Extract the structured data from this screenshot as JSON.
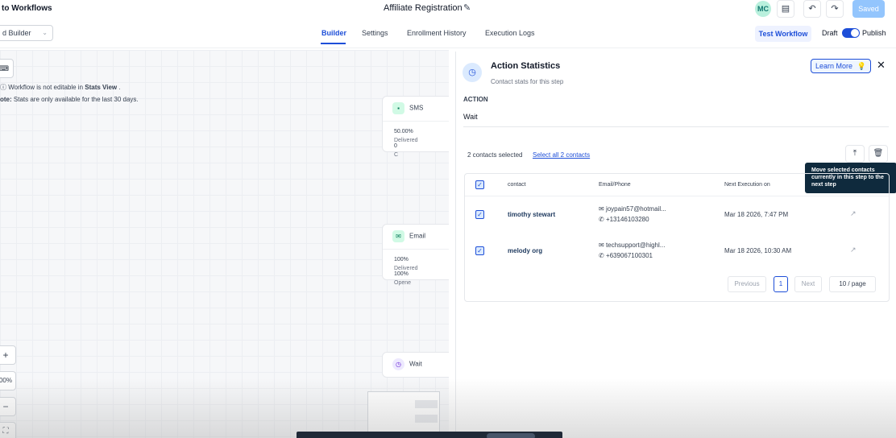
{
  "header": {
    "back_label": "to Workflows",
    "workflow_title": "Affiliate Registration",
    "avatar_initials": "MC",
    "saved_label": "Saved"
  },
  "navbar": {
    "builder_select_value": "d Builder",
    "tabs": [
      {
        "label": "Builder",
        "active": true
      },
      {
        "label": "Settings",
        "active": false
      },
      {
        "label": "Enrollment History",
        "active": false
      },
      {
        "label": "Execution Logs",
        "active": false
      }
    ],
    "test_workflow_label": "Test Workflow",
    "draft_label": "Draft",
    "publish_label": "Publish"
  },
  "canvas": {
    "note1_prefix": "Workflow is not editable in ",
    "note1_bold": "Stats View",
    "note1_suffix": " .",
    "note2_prefix": "ote:",
    "note2_text": " Stats are only available for the last 30 days.",
    "nodes": [
      {
        "name": "SMS",
        "stat1_value": "50.00%",
        "stat1_label": "Delivered",
        "stat2_value": "0",
        "stat2_label": "C"
      },
      {
        "name": "Email",
        "stat1_value": "100%",
        "stat1_label": "Delivered",
        "stat2_value": "100%",
        "stat2_label": "Opene"
      },
      {
        "name": "Wait"
      }
    ],
    "zoom_in": "+",
    "zoom_level": "00%",
    "zoom_out": "−",
    "fit": "⛶"
  },
  "panel": {
    "title": "Action Statistics",
    "subtitle": "Contact stats for this step",
    "learn_more": "Learn More",
    "action_label": "ACTION",
    "action_value": "Wait",
    "selected_count": "2 contacts selected",
    "select_all": "Select all 2 contacts",
    "tooltip": "Move selected contacts currently in this step to the next step",
    "table": {
      "headers": {
        "contact": "contact",
        "email_phone": "Email/Phone",
        "next_execution": "Next Execution on"
      },
      "rows": [
        {
          "contact": "timothy stewart",
          "email": "joypain57@hotmail...",
          "phone": "+13146103280",
          "next": "Mar 18 2026, 7:47 PM"
        },
        {
          "contact": "melody org",
          "email": "techsupport@highl...",
          "phone": "+639067100301",
          "next": "Mar 18 2026, 10:30 AM"
        }
      ]
    },
    "pagination": {
      "previous": "Previous",
      "page": "1",
      "next": "Next",
      "page_size": "10 / page"
    }
  },
  "colors": {
    "accent": "#1d4ed8",
    "tooltip_bg": "#0f2a3d",
    "saved_bg": "#93c5fd"
  }
}
